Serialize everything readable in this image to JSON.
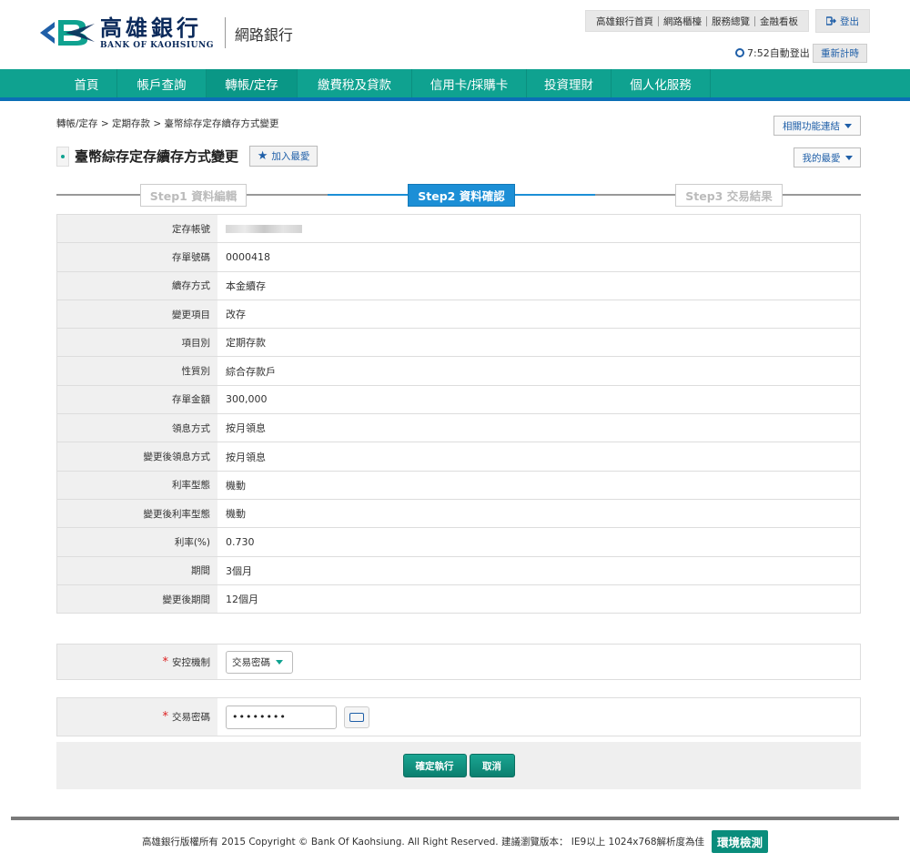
{
  "header": {
    "logo_cn": "高雄銀行",
    "logo_en": "BANK OF KAOHSIUNG",
    "logo_sub": "網路銀行",
    "top_links": [
      "高雄銀行首頁",
      "網路櫃檯",
      "服務總覽",
      "金融看板"
    ],
    "logout_label": "登出",
    "timer_text": "7:52自動登出",
    "retime_label": "重新計時"
  },
  "nav": {
    "items": [
      "首頁",
      "帳戶查詢",
      "轉帳/定存",
      "繳費稅及貸款",
      "信用卡/採購卡",
      "投資理財",
      "個人化服務"
    ],
    "active": "轉帳/定存"
  },
  "breadcrumb": "轉帳/定存 > 定期存款 > 臺幣綜存定存續存方式變更",
  "related_label": "相關功能連結",
  "page_title": "臺幣綜存定存續存方式變更",
  "add_fav_label": "加入最愛",
  "my_fav_label": "我的最愛",
  "steps": [
    "Step1 資料編輯",
    "Step2 資料確認",
    "Step3 交易結果"
  ],
  "current_step": 2,
  "details": [
    {
      "label": "定存帳號",
      "value": ""
    },
    {
      "label": "存單號碼",
      "value": "0000418"
    },
    {
      "label": "續存方式",
      "value": "本金續存"
    },
    {
      "label": "變更項目",
      "value": "改存"
    },
    {
      "label": "項目別",
      "value": "定期存款"
    },
    {
      "label": "性質別",
      "value": "綜合存款戶"
    },
    {
      "label": "存單金額",
      "value": "300,000"
    },
    {
      "label": "領息方式",
      "value": "按月領息"
    },
    {
      "label": "變更後領息方式",
      "value": "按月領息"
    },
    {
      "label": "利率型態",
      "value": "機動"
    },
    {
      "label": "變更後利率型態",
      "value": "機動"
    },
    {
      "label": "利率(%)",
      "value": "0.730"
    },
    {
      "label": "期間",
      "value": "3個月"
    },
    {
      "label": "變更後期間",
      "value": "12個月"
    }
  ],
  "security": {
    "label": "安控機制",
    "selected": "交易密碼"
  },
  "password": {
    "label": "交易密碼",
    "value": "••••••••"
  },
  "buttons": {
    "confirm": "確定執行",
    "cancel": "取消"
  },
  "footer": {
    "text": "高雄銀行版權所有 2015 Copyright © Bank Of Kaohsiung. All Right Reserved. 建議瀏覽版本： IE9以上 1024x768解析度為佳",
    "env_label": "環境檢測"
  },
  "colors": {
    "nav_bg": "#0fa290",
    "nav_border": "#0b6fb5",
    "step_active": "#1c8fd6",
    "button": "#0b7f6f"
  }
}
